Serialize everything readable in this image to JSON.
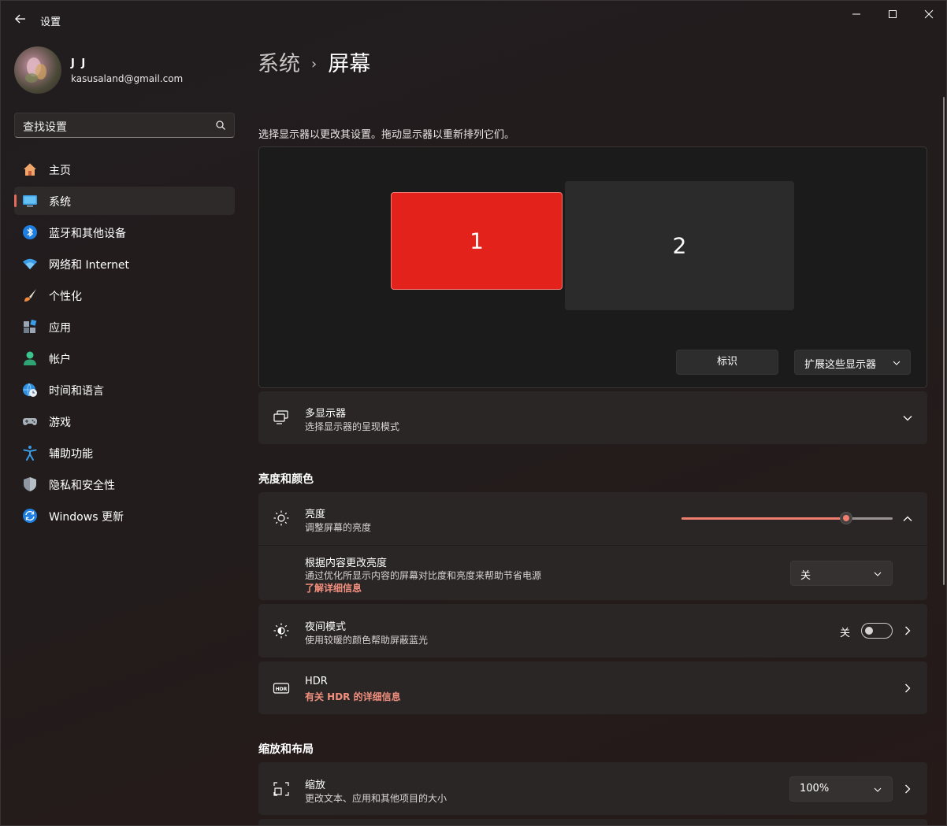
{
  "window": {
    "title": "设置"
  },
  "profile": {
    "name": "J J",
    "email": "kasusaland@gmail.com"
  },
  "search": {
    "placeholder": "查找设置"
  },
  "sidebar": {
    "items": [
      {
        "label": "主页",
        "icon": "home-icon"
      },
      {
        "label": "系统",
        "icon": "system-icon",
        "active": true
      },
      {
        "label": "蓝牙和其他设备",
        "icon": "bluetooth-icon"
      },
      {
        "label": "网络和 Internet",
        "icon": "wifi-icon"
      },
      {
        "label": "个性化",
        "icon": "brush-icon"
      },
      {
        "label": "应用",
        "icon": "apps-icon"
      },
      {
        "label": "帐户",
        "icon": "account-icon"
      },
      {
        "label": "时间和语言",
        "icon": "globe-clock-icon"
      },
      {
        "label": "游戏",
        "icon": "gamepad-icon"
      },
      {
        "label": "辅助功能",
        "icon": "accessibility-icon"
      },
      {
        "label": "隐私和安全性",
        "icon": "shield-icon"
      },
      {
        "label": "Windows 更新",
        "icon": "update-icon"
      }
    ]
  },
  "header": {
    "breadcrumb_parent": "系统",
    "breadcrumb_current": "屏幕"
  },
  "display_arrangement": {
    "hint": "选择显示器以更改其设置。拖动显示器以重新排列它们。",
    "monitors": [
      {
        "number": "1",
        "selected": true
      },
      {
        "number": "2"
      }
    ],
    "identify_label": "标识",
    "mode_label": "扩展这些显示器"
  },
  "multi_display": {
    "title": "多显示器",
    "subtitle": "选择显示器的呈现模式"
  },
  "brightness_section": {
    "heading": "亮度和颜色",
    "brightness": {
      "title": "亮度",
      "subtitle": "调整屏幕的亮度",
      "value_fraction": 0.78
    },
    "content_adaptive": {
      "title": "根据内容更改亮度",
      "subtitle": "通过优化所显示内容的屏幕对比度和亮度来帮助节省电源",
      "link": "了解详细信息",
      "value": "关"
    },
    "night_light": {
      "title": "夜间模式",
      "subtitle": "使用较暖的颜色帮助屏蔽蓝光",
      "state_label": "关",
      "on": false
    },
    "hdr": {
      "title": "HDR",
      "link": "有关 HDR 的详细信息"
    }
  },
  "scale_section": {
    "heading": "缩放和布局",
    "scale": {
      "title": "缩放",
      "subtitle": "更改文本、应用和其他项目的大小",
      "value": "100%"
    }
  },
  "colors": {
    "accent": "#e46b5c",
    "monitor_selected": "#e3231b",
    "link": "#f28f7e"
  }
}
